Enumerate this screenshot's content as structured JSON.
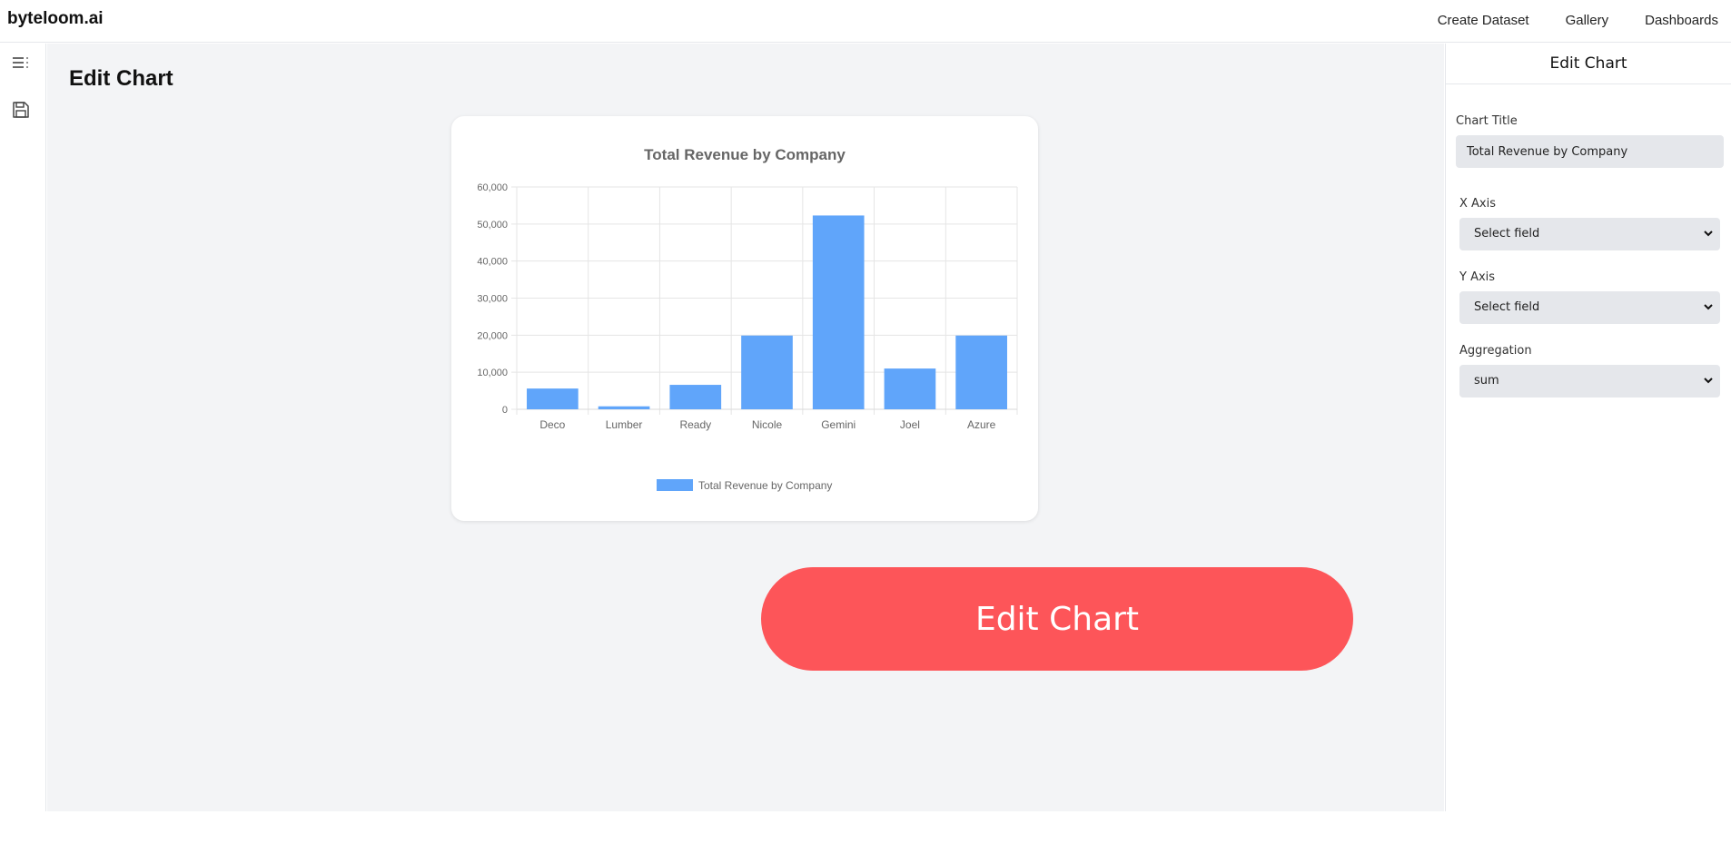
{
  "brand": "byteloom.ai",
  "nav": [
    "Create Dataset",
    "Gallery",
    "Dashboards"
  ],
  "rail_icons": [
    "menu-icon",
    "save-icon"
  ],
  "page_title": "Edit Chart",
  "edit_button_label": "Edit Chart",
  "panel": {
    "title": "Edit Chart",
    "chart_title_label": "Chart Title",
    "chart_title_value": "Total Revenue by Company",
    "x_axis_label": "X Axis",
    "x_axis_value": "Select field",
    "y_axis_label": "Y Axis",
    "y_axis_value": "Select field",
    "aggregation_label": "Aggregation",
    "aggregation_value": "sum"
  },
  "colors": {
    "bar": "#60a5fa",
    "accent_button": "#fd5559"
  },
  "chart_data": {
    "type": "bar",
    "title": "Total Revenue by Company",
    "categories": [
      "Deco",
      "Lumber",
      "Ready",
      "Nicole",
      "Gemini",
      "Joel",
      "Azure"
    ],
    "series": [
      {
        "name": "Total Revenue by Company",
        "values": [
          5600,
          800,
          6600,
          19900,
          52300,
          11000,
          19900
        ]
      }
    ],
    "ylim": [
      0,
      60000
    ],
    "yticks": [
      "0",
      "10,000",
      "20,000",
      "30,000",
      "40,000",
      "50,000",
      "60,000"
    ],
    "xlabel": "",
    "ylabel": "",
    "grid": true,
    "legend": "bottom"
  }
}
